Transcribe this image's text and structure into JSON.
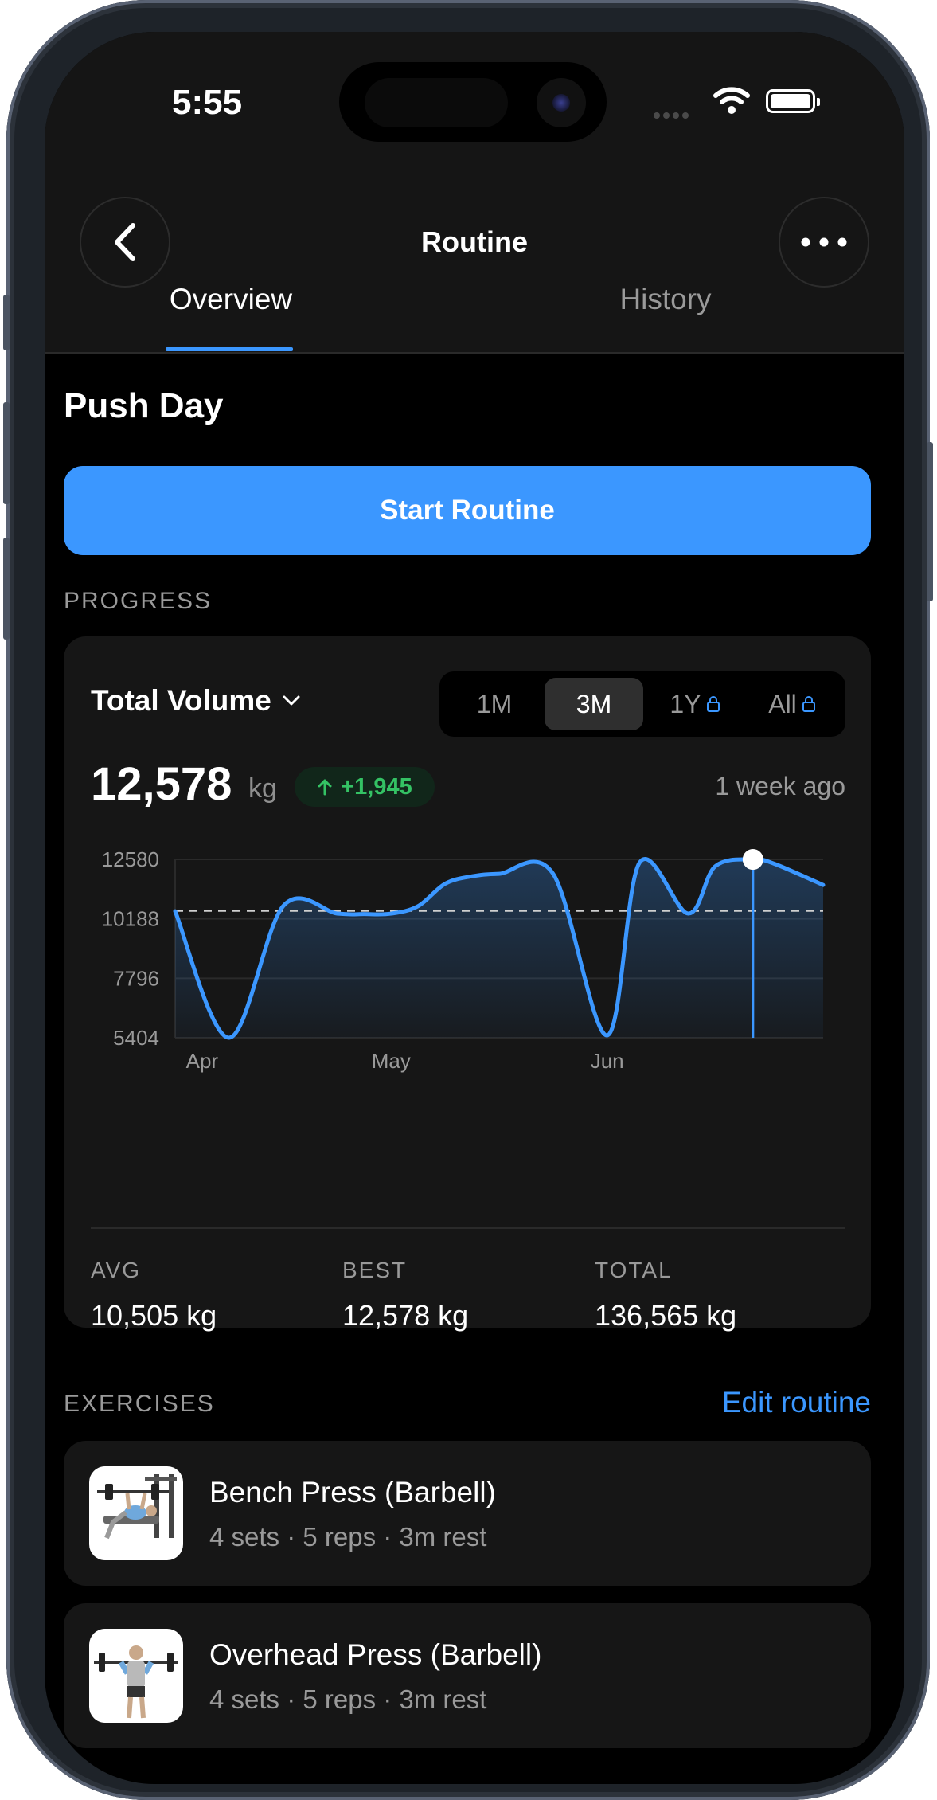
{
  "status_bar": {
    "time": "5:55"
  },
  "nav": {
    "title": "Routine",
    "back_icon": "chevron-left-icon",
    "more_icon": "ellipsis-icon"
  },
  "tabs": [
    {
      "label": "Overview",
      "active": true
    },
    {
      "label": "History",
      "active": false
    }
  ],
  "routine": {
    "title": "Push Day",
    "start_label": "Start Routine"
  },
  "progress": {
    "section_label": "PROGRESS",
    "metric_label": "Total Volume",
    "ranges": [
      {
        "label": "1M",
        "active": false,
        "locked": false
      },
      {
        "label": "3M",
        "active": true,
        "locked": false
      },
      {
        "label": "1Y",
        "active": false,
        "locked": true
      },
      {
        "label": "All",
        "active": false,
        "locked": true
      }
    ],
    "current_value": "12,578",
    "unit": "kg",
    "change": "+1,945",
    "timestamp": "1 week ago",
    "stats": [
      {
        "label": "AVG",
        "value": "10,505 kg"
      },
      {
        "label": "BEST",
        "value": "12,578 kg"
      },
      {
        "label": "TOTAL",
        "value": "136,565 kg"
      }
    ]
  },
  "chart_data": {
    "type": "line",
    "title": "",
    "xlabel": "",
    "ylabel": "",
    "ylim": [
      5404,
      12580
    ],
    "y_ticks": [
      "12580",
      "10188",
      "7796",
      "5404"
    ],
    "x_ticks": [
      {
        "label": "Apr",
        "x": 5
      },
      {
        "label": "May",
        "x": 40
      },
      {
        "label": "Jun",
        "x": 80
      }
    ],
    "x": [
      0,
      10,
      20,
      30,
      35,
      40,
      45,
      50,
      55,
      60,
      70,
      80,
      86,
      95,
      100,
      107,
      111,
      120
    ],
    "values": [
      10495,
      5404,
      10700,
      10400,
      10380,
      10400,
      10700,
      11600,
      11900,
      12000,
      12000,
      5500,
      12450,
      10400,
      12300,
      12578,
      12400,
      11550
    ],
    "average": 10505,
    "highlight_index": 15,
    "line_color": "#3b97ff"
  },
  "exercises": {
    "section_label": "EXERCISES",
    "edit_label": "Edit routine",
    "items": [
      {
        "name": "Bench Press (Barbell)",
        "meta": "4 sets · 5 reps · 3m rest"
      },
      {
        "name": "Overhead Press (Barbell)",
        "meta": "4 sets · 5 reps · 3m rest"
      }
    ]
  }
}
